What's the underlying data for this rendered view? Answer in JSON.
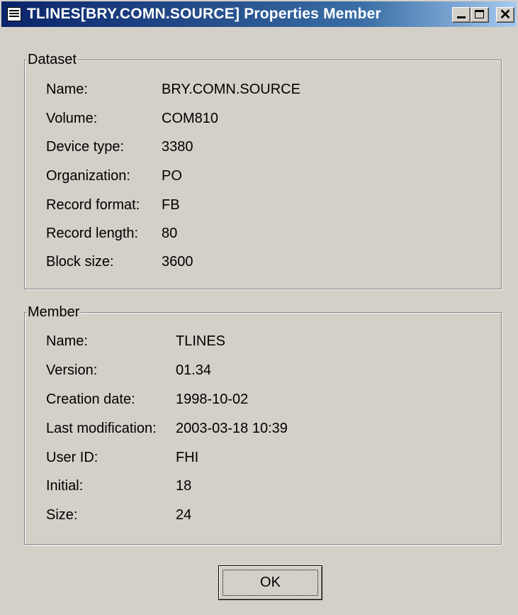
{
  "window": {
    "title": "TLINES[BRY.COMN.SOURCE] Properties Member",
    "icon": "properties-icon",
    "controls": [
      "minimize",
      "maximize",
      "close"
    ],
    "close_glyph": "✕"
  },
  "dataset": {
    "legend": "Dataset",
    "fields": [
      {
        "label": "Name:",
        "value": "BRY.COMN.SOURCE"
      },
      {
        "label": "Volume:",
        "value": "COM810"
      },
      {
        "label": "Device type:",
        "value": "3380"
      },
      {
        "label": "Organization:",
        "value": "PO"
      },
      {
        "label": "Record format:",
        "value": "FB"
      },
      {
        "label": "Record length:",
        "value": "80"
      },
      {
        "label": "Block size:",
        "value": "3600"
      }
    ]
  },
  "member": {
    "legend": "Member",
    "fields": [
      {
        "label": "Name:",
        "value": "TLINES"
      },
      {
        "label": "Version:",
        "value": "01.34"
      },
      {
        "label": "Creation date:",
        "value": "1998-10-02"
      },
      {
        "label": "Last modification:",
        "value": "2003-03-18 10:39"
      },
      {
        "label": "User ID:",
        "value": "FHI"
      },
      {
        "label": "Initial:",
        "value": "18"
      },
      {
        "label": "Size:",
        "value": "24"
      }
    ]
  },
  "ok_button": {
    "label": "OK"
  }
}
